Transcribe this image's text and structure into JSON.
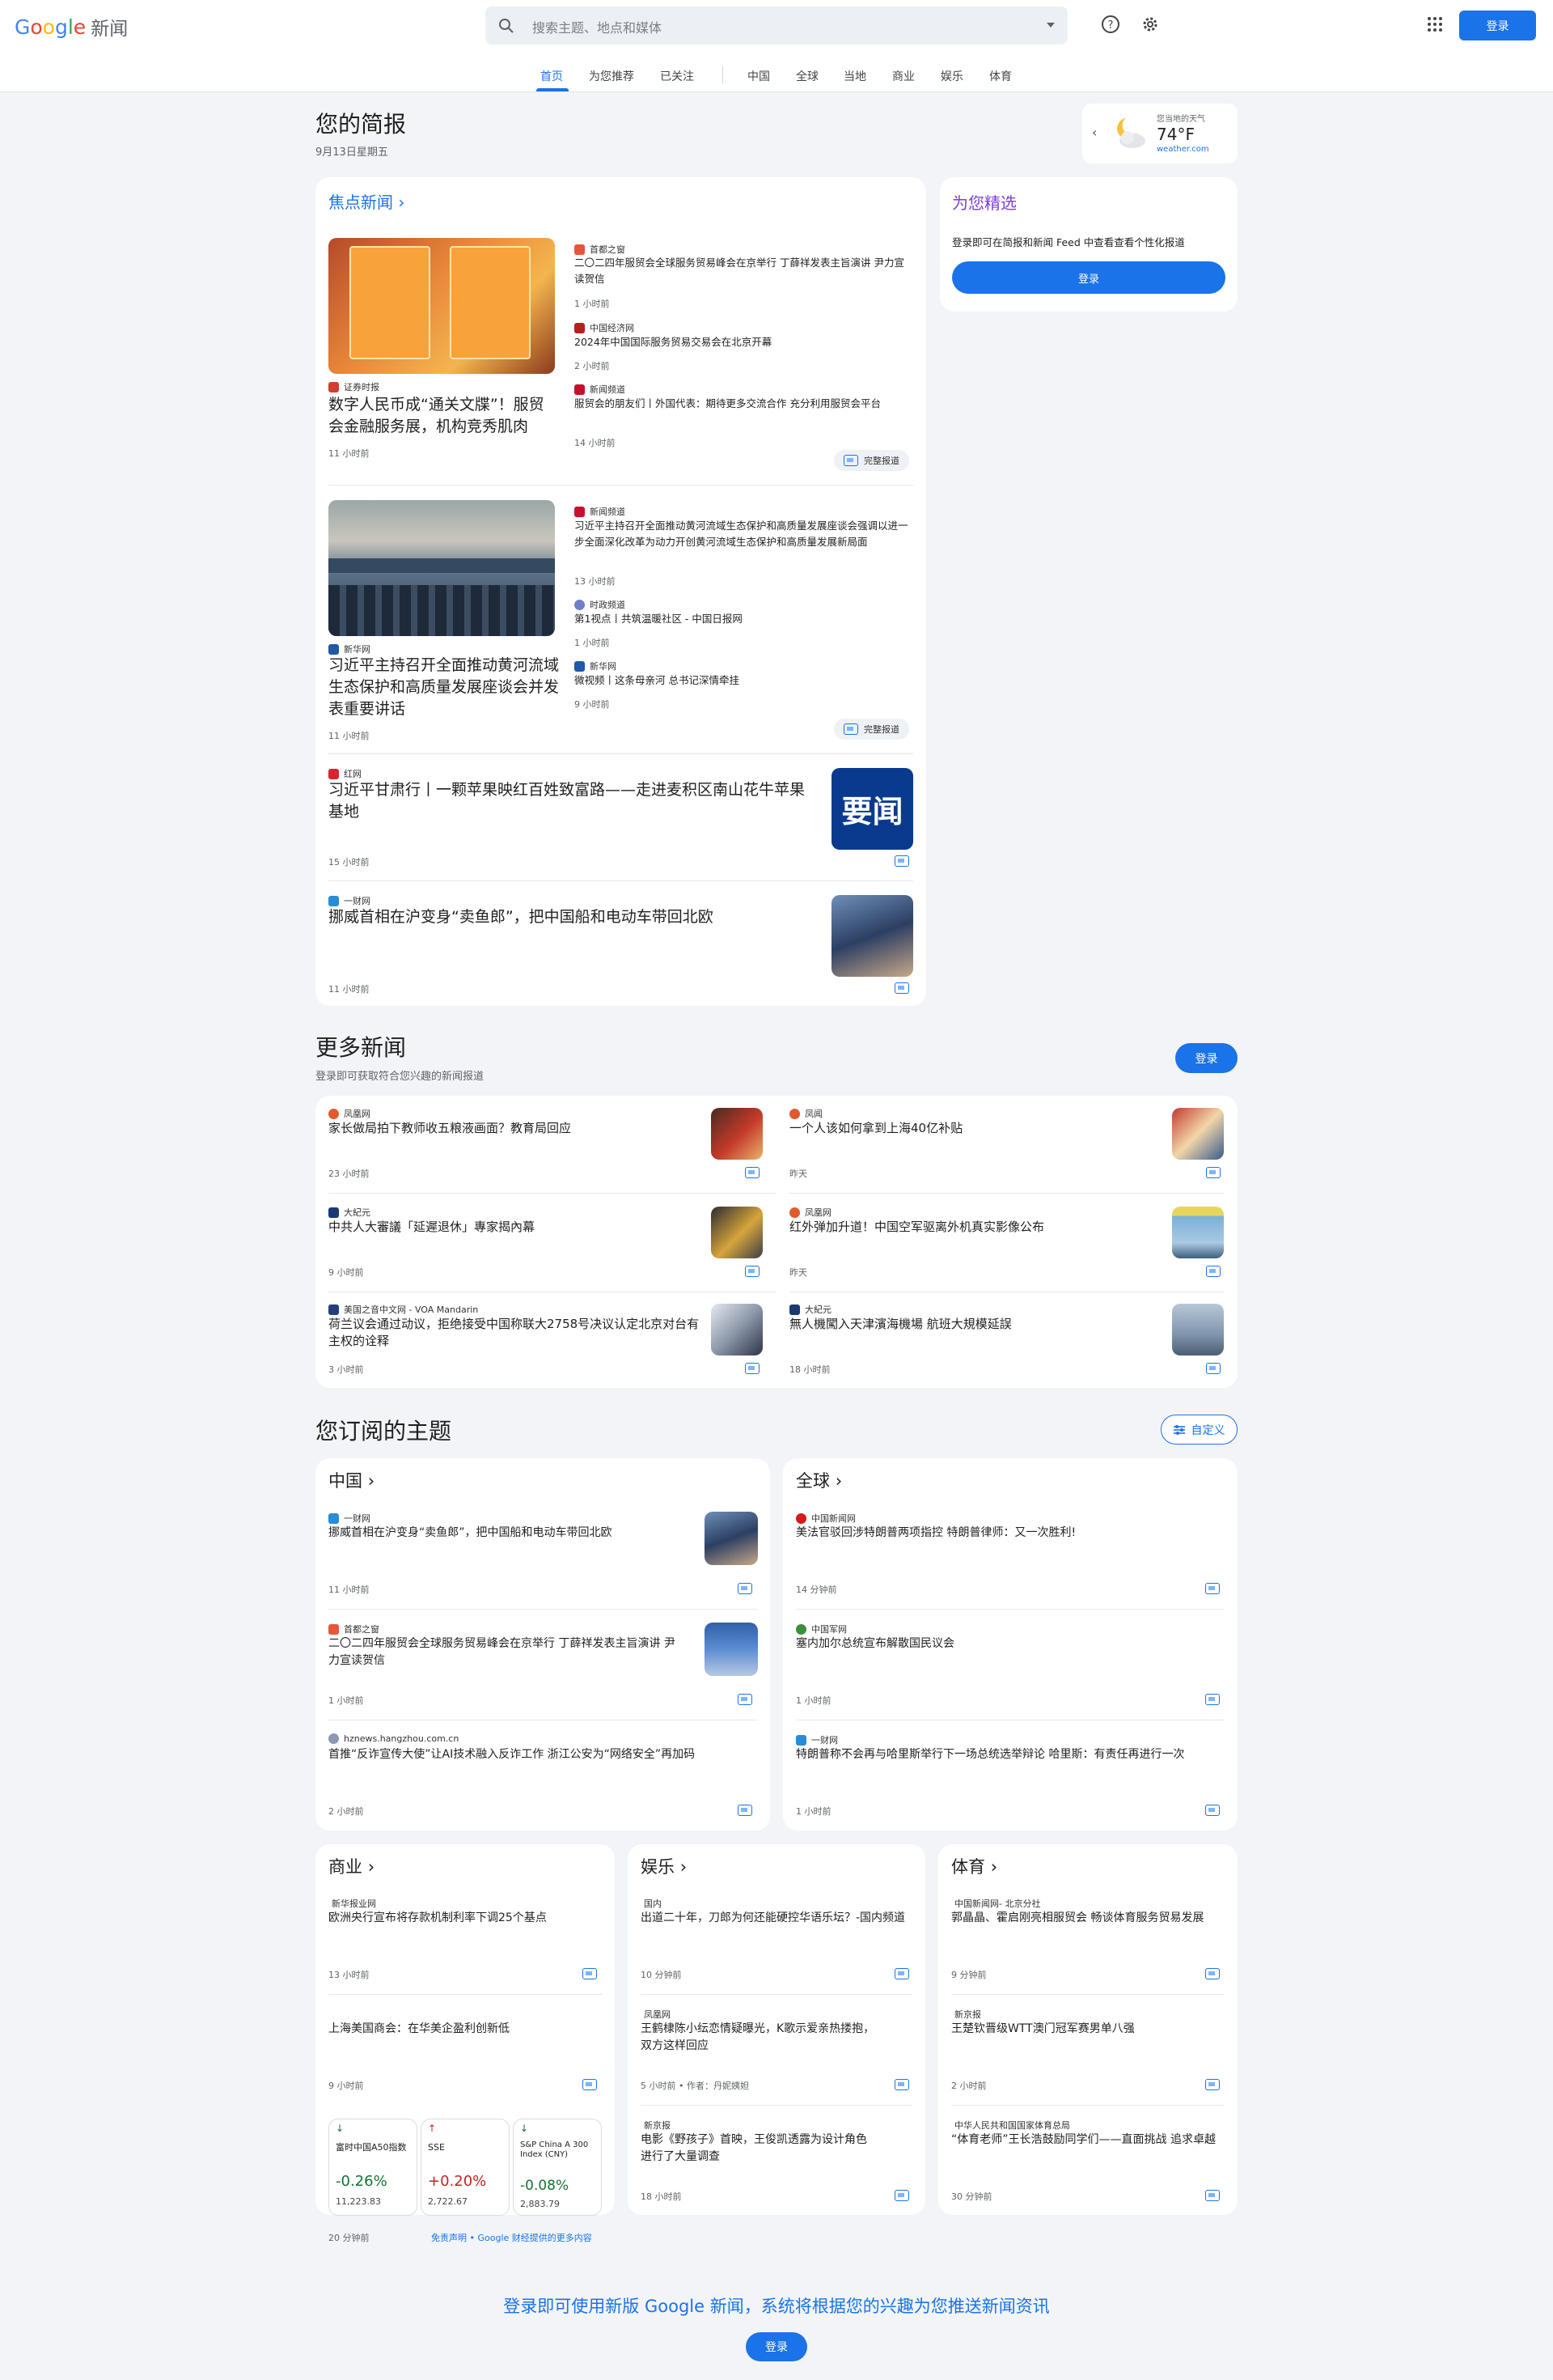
{
  "header": {
    "logo": "Google",
    "logo_news": "新闻",
    "search_placeholder": "搜索主题、地点和媒体",
    "signin": "登录"
  },
  "tabs": [
    "首页",
    "为您推荐",
    "已关注",
    "中国",
    "全球",
    "当地",
    "商业",
    "娱乐",
    "体育"
  ],
  "briefing": {
    "title": "您的简报",
    "date": "9月13日星期五"
  },
  "weather": {
    "label": "您当地的天气",
    "temp": "74°F",
    "source": "weather.com"
  },
  "top_stories": {
    "heading": "焦点新闻",
    "full_coverage": "完整报道",
    "cluster1": {
      "main_source": "证券时报",
      "main_title": "数字人民币成“通关文牒”！服贸会金融服务展，机构竞秀肌肉",
      "main_time": "11 小时前",
      "side": [
        {
          "source": "首都之窗",
          "title": "二〇二四年服贸会全球服务贸易峰会在京举行 丁薛祥发表主旨演讲 尹力宣读贺信",
          "time": "1 小时前"
        },
        {
          "source": "中国经济网",
          "title": "2024年中国国际服务贸易交易会在北京开幕",
          "time": "2 小时前"
        },
        {
          "source": "新闻频道",
          "title": "服贸会的朋友们丨外国代表：期待更多交流合作 充分利用服贸会平台",
          "time": "14 小时前"
        }
      ]
    },
    "cluster2": {
      "main_source": "新华网",
      "main_title": "习近平主持召开全面推动黄河流域生态保护和高质量发展座谈会并发表重要讲话",
      "main_time": "11 小时前",
      "side": [
        {
          "source": "新闻频道",
          "title": "习近平主持召开全面推动黄河流域生态保护和高质量发展座谈会强调以进一步全面深化改革为动力开创黄河流域生态保护和高质量发展新局面",
          "time": "13 小时前"
        },
        {
          "source": "时政频道",
          "title": "第1视点丨共筑温暖社区 - 中国日报网",
          "time": "1 小时前"
        },
        {
          "source": "新华网",
          "title": "微视频丨这条母亲河 总书记深情牵挂",
          "time": "9 小时前"
        }
      ]
    },
    "single": [
      {
        "source": "红网",
        "title": "习近平甘肃行丨一颗苹果映红百姓致富路——走进麦积区南山花牛苹果基地",
        "time": "15 小时前",
        "thumb_text": "要闻"
      },
      {
        "source": "一财网",
        "title": "挪威首相在沪变身“卖鱼郎”，把中国船和电动车带回北欧",
        "time": "11 小时前"
      }
    ]
  },
  "for_you": {
    "heading": "为您精选",
    "text": "登录即可在简报和新闻 Feed 中查看查看个性化报道",
    "button": "登录"
  },
  "more_news": {
    "title": "更多新闻",
    "subtitle": "登录即可获取符合您兴趣的新闻报道",
    "button": "登录",
    "items": [
      {
        "source": "凤凰网",
        "title": "家长做局拍下教师收五粮液画面？教育局回应",
        "time": "23 小时前"
      },
      {
        "source": "凤闻",
        "title": "一个人该如何拿到上海40亿补贴",
        "time": "昨天"
      },
      {
        "source": "大紀元",
        "title": "中共人大審議「延遲退休」專家揭內幕",
        "time": "9 小时前"
      },
      {
        "source": "凤凰网",
        "title": "红外弹加升道！中国空军驱离外机真实影像公布",
        "time": "昨天"
      },
      {
        "source": "美国之音中文网 - VOA Mandarin",
        "title": "荷兰议会通过动议，拒绝接受中国称联大2758号决议认定北京对台有主权的诠释",
        "time": "3 小时前"
      },
      {
        "source": "大紀元",
        "title": "無人機闖入天津濱海機場 航班大規模延誤",
        "time": "18 小时前"
      }
    ]
  },
  "topics": {
    "title": "您订阅的主题",
    "customize": "自定义",
    "china": {
      "label": "中国",
      "items": [
        {
          "source": "一财网",
          "title": "挪威首相在沪变身“卖鱼郎”，把中国船和电动车带回北欧",
          "time": "11 小时前"
        },
        {
          "source": "首都之窗",
          "title": "二〇二四年服贸会全球服务贸易峰会在京举行 丁薛祥发表主旨演讲 尹力宣读贺信",
          "time": "1 小时前"
        },
        {
          "source": "hznews.hangzhou.com.cn",
          "title": "首推“反诈宣传大使”让AI技术融入反诈工作 浙江公安为“网络安全”再加码",
          "time": "2 小时前"
        }
      ]
    },
    "world": {
      "label": "全球",
      "items": [
        {
          "source": "中国新闻网",
          "title": "美法官驳回涉特朗普两项指控 特朗普律师：又一次胜利!",
          "time": "14 分钟前"
        },
        {
          "source": "中国军网",
          "title": "塞内加尔总统宣布解散国民议会",
          "time": "1 小时前"
        },
        {
          "source": "一财网",
          "title": "特朗普称不会再与哈里斯举行下一场总统选举辩论 哈里斯：有责任再进行一次",
          "time": "1 小时前"
        }
      ]
    },
    "business": {
      "label": "商业",
      "items": [
        {
          "source": "新华报业网",
          "title": "欧洲央行宣布将存款机制利率下调25个基点",
          "time": "13 小时前"
        },
        {
          "source": "",
          "title": "上海美国商会：在华美企盈利创新低",
          "time": "9 小时前"
        }
      ],
      "stocks": [
        {
          "name": "富时中国A50指数",
          "change": "-0.26%",
          "value": "11,223.83",
          "dir": "down"
        },
        {
          "name": "SSE",
          "change": "+0.20%",
          "value": "2,722.67",
          "dir": "up"
        },
        {
          "name": "S&P China A 300 Index (CNY)",
          "change": "-0.08%",
          "value": "2,883.79",
          "dir": "down"
        }
      ],
      "stocks_time": "20 分钟前",
      "disclaimer": "免责声明 • Google 财经提供的更多内容"
    },
    "entertainment": {
      "label": "娱乐",
      "items": [
        {
          "source": "国内",
          "title": "出道二十年，刀郎为何还能硬控华语乐坛？-国内频道",
          "time": "10 分钟前"
        },
        {
          "source": "凤凰网",
          "title": "王鹤棣陈小纭恋情疑曝光，K歌示爱亲热搂抱，双方这样回应",
          "time": "5 小时前 • 作者：丹妮姨妲"
        },
        {
          "source": "新京报",
          "title": "电影《野孩子》首映，王俊凯透露为设计角色进行了大量调查",
          "time": "18 小时前"
        }
      ]
    },
    "sports": {
      "label": "体育",
      "items": [
        {
          "source": "中国新闻网- 北京分社",
          "title": "郭晶晶、霍启刚亮相服贸会 畅谈体育服务贸易发展",
          "time": "9 分钟前"
        },
        {
          "source": "新京报",
          "title": "王楚钦晋级WTT澳门冠军赛男单八强",
          "time": "2 小时前"
        },
        {
          "source": "中华人民共和国国家体育总局",
          "title": "“体育老师”王长浩鼓励同学们——直面挑战 追求卓越",
          "time": "30 分钟前"
        }
      ]
    }
  },
  "footer": {
    "text": "登录即可使用新版 Google 新闻，系统将根据您的兴趣为您推送新闻资讯",
    "button": "登录"
  },
  "colors": {
    "accent": "#1a73e8",
    "down": "#137333",
    "up": "#c5221f",
    "bg": "#f2f4f7"
  }
}
